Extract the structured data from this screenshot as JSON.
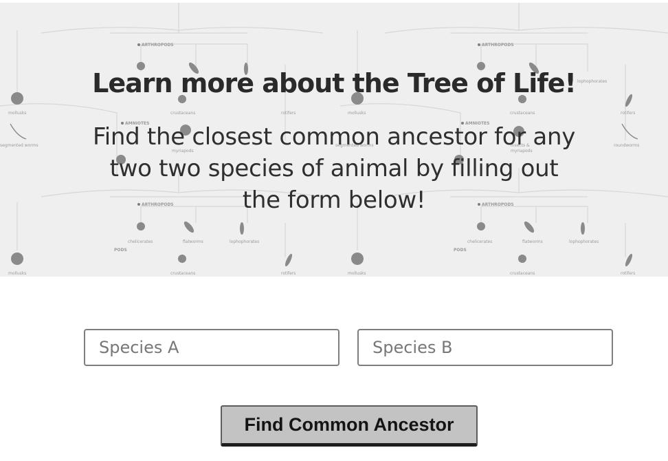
{
  "hero": {
    "title": "Learn more about the Tree of Life!",
    "text": "Find the closest common ancestor for any two two species of animal by filling out the form below!",
    "background_labels": {
      "arthropods": "ARTHROPODS",
      "amniotes": "AMNIOTES",
      "pods": "PODS",
      "mollusks": "mollusks",
      "segmented_worms": "segmented worms",
      "crustaceans": "crustaceans",
      "rotifers": "rotifers",
      "myriapods": "myriapods",
      "insects": "insects &",
      "roundworms": "roundworms",
      "chelicerates": "chelicerates",
      "flatworms": "flatworms",
      "lophophorates": "lophophorates"
    }
  },
  "form": {
    "species_a_placeholder": "Species A",
    "species_b_placeholder": "Species B",
    "submit_label": "Find Common Ancestor"
  },
  "colors": {
    "hero_background": "#efefef",
    "button_background": "#c3c3c3",
    "input_border": "#7d7d7d"
  }
}
